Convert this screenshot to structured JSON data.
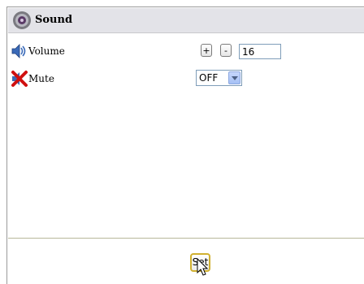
{
  "panel": {
    "title": "Sound",
    "icon": "speaker-disc-icon"
  },
  "volume": {
    "label": "Volume",
    "icon": "volume-speaker-icon",
    "plus_label": "+",
    "minus_label": "-",
    "value": "16"
  },
  "mute": {
    "label": "Mute",
    "icon": "mute-x-icon",
    "selected": "OFF"
  },
  "footer": {
    "set_label": "Set"
  },
  "colors": {
    "header_bg": "#e3e3e8",
    "set_border": "#d0b030",
    "mute_red": "#d01010"
  }
}
